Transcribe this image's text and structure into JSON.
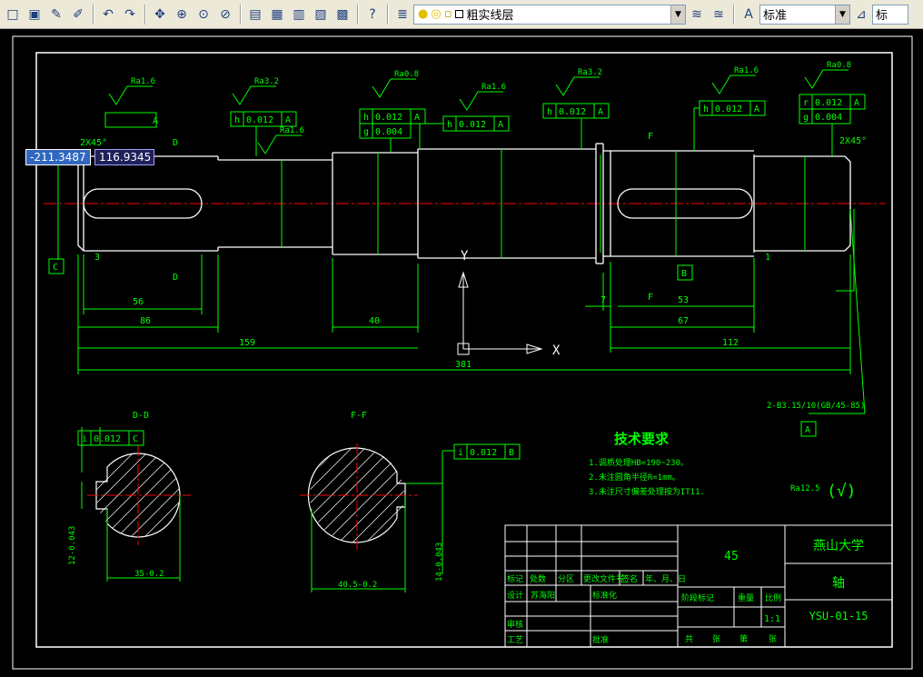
{
  "toolbar": {
    "buttons": [
      {
        "name": "new-icon",
        "glyph": "□"
      },
      {
        "name": "open-icon",
        "glyph": "▣"
      },
      {
        "name": "pencil-icon",
        "glyph": "✎"
      },
      {
        "name": "match-properties-icon",
        "glyph": "✐"
      },
      {
        "name": "undo-icon",
        "glyph": "↶"
      },
      {
        "name": "redo-icon",
        "glyph": "↷"
      },
      {
        "name": "pan-icon",
        "glyph": "✥"
      },
      {
        "name": "zoom-realtime-icon",
        "glyph": "⊕"
      },
      {
        "name": "zoom-window-icon",
        "glyph": "⊙"
      },
      {
        "name": "zoom-previous-icon",
        "glyph": "⊘"
      },
      {
        "name": "properties-icon",
        "glyph": "▤"
      },
      {
        "name": "design-center-icon",
        "glyph": "▦"
      },
      {
        "name": "tool-palette-icon",
        "glyph": "▥"
      },
      {
        "name": "markup-icon",
        "glyph": "▧"
      },
      {
        "name": "calculator-icon",
        "glyph": "▩"
      },
      {
        "name": "help-icon",
        "glyph": "?"
      }
    ],
    "layer_combo_value": "粗实线层",
    "text_style_value": "标准",
    "dim_style_value": "标"
  },
  "coord_tip": {
    "x": "-211.3487",
    "y": "116.9345"
  },
  "drawing": {
    "color_line": "#00ff00",
    "color_center": "#ff0000",
    "color_white": "#ffffff",
    "surface_roughness": [
      "Ra1.6",
      "Ra3.2",
      "Ra1.6",
      "Ra0.8",
      "Ra1.6",
      "Ra3.2",
      "Ra1.6",
      "Ra0.8",
      "Ra3.2",
      "Ra12.5"
    ],
    "tolerance_frames": [
      {
        "sym": "h",
        "val": "0.012",
        "datum": "A"
      },
      {
        "sym": "h",
        "val": "0.012",
        "datum": "A"
      },
      {
        "sym": "h",
        "val": "0.012",
        "datum": "A"
      },
      {
        "sym": "g",
        "val": "0.004",
        "datum": ""
      },
      {
        "sym": "h",
        "val": "0.012",
        "datum": "A"
      },
      {
        "sym": "h",
        "val": "0.012",
        "datum": "A"
      },
      {
        "sym": "h",
        "val": "0.012",
        "datum": "A"
      },
      {
        "sym": "r",
        "val": "0.012",
        "datum": "A"
      },
      {
        "sym": "g",
        "val": "0.004",
        "datum": ""
      },
      {
        "sym": "i",
        "val": "0.012",
        "datum": "C"
      },
      {
        "sym": "i",
        "val": "0.012",
        "datum": "B"
      }
    ],
    "chamfer_left": "2X45°",
    "chamfer_right": "2X45°",
    "dims": {
      "d56": "56",
      "d86": "86",
      "d40": "40",
      "d159": "159",
      "d381": "381",
      "d7": "7",
      "d53": "53",
      "d67": "67",
      "d112": "112",
      "d3": "3",
      "d1": "1"
    },
    "labels": {
      "section_d": "D",
      "section_f": "F",
      "datum_c": "C",
      "datum_b": "B",
      "datum_a": "A",
      "view_dd": "D-D",
      "view_ff": "F-F",
      "axis_y": "Y",
      "axis_x": "X",
      "center_hole": "2-B3.15/10(GB/45-85)",
      "dim_35": "35-0.2",
      "dim_405": "40.5-0.2",
      "dim_12": "12-0.043",
      "dim_14": "14-0.043"
    },
    "tech_req": {
      "title": "技术要求",
      "items": [
        "1.调质处理HB=190~230。",
        "2.未注圆角半径R=1mm。",
        "3.未注尺寸偏差处理按为IT11."
      ]
    },
    "rough_other": "(√)",
    "title_block": {
      "material": "45",
      "school": "燕山大学",
      "part_name": "轴",
      "drawing_no": "YSU-01-15",
      "scale": "1:1",
      "headers": [
        "标记",
        "处数",
        "分区",
        "更改文件号",
        "签名",
        "年、月、日"
      ],
      "row_design": [
        "设计",
        "苏海阳",
        "标准化"
      ],
      "row_check": "审核",
      "row_process": "工艺",
      "approve": "批准",
      "stage_labels": [
        "阶段标记",
        "重量",
        "比例"
      ],
      "sheet_labels": [
        "共",
        "张",
        "第",
        "张"
      ]
    }
  }
}
